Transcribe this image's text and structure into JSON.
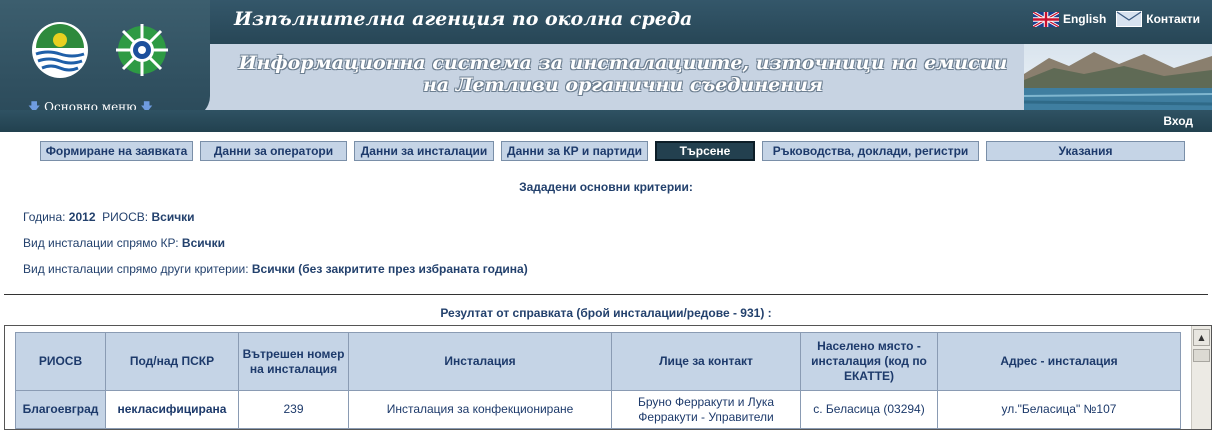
{
  "header": {
    "agency_title": "Изпълнителна агенция по околна среда",
    "system_title": "Информационна система за инсталациите, източници на емисии на Летливи органични съединения",
    "menu_label": "Основно меню",
    "english_label": "English",
    "contacts_label": "Контакти",
    "login_label": "Вход"
  },
  "nav": {
    "items": [
      "Формиране на заявката",
      "Данни за оператори",
      "Данни за инсталации",
      "Данни за КР и партиди",
      "Търсене",
      "Ръководства, доклади, регистри",
      "Указания"
    ],
    "active": "Търсене"
  },
  "criteria": {
    "heading": "Зададени основни критерии:",
    "year_label": "Година:",
    "year_value": "2012",
    "riosv_label": "РИОСВ:",
    "riosv_value": "Всички",
    "kr_label": "Вид инсталации спрямо КР:",
    "kr_value": "Всички",
    "other_label": "Вид инсталации спрямо други критерии:",
    "other_value": "Всички (без закритите през избраната година)"
  },
  "results": {
    "heading": "Резултат от справката (брой инсталации/редове - 931) :",
    "columns": [
      "РИОСВ",
      "Под/над ПСКР",
      "Вътрешен номер на инсталация",
      "Инсталация",
      "Лице за контакт",
      "Населено място - инсталация (код по ЕКАТТЕ)",
      "Адрес - инсталация"
    ],
    "rows": [
      {
        "riosv": "Благоевград",
        "pskr": "некласифицирана",
        "internal_no": "239",
        "installation": "Инсталация за конфекциониране",
        "contact": "Бруно Ферракути и Лука Ферракути - Управители",
        "settlement": "с. Беласица (03294)",
        "address": "ул.\"Беласица\" №107"
      }
    ]
  },
  "colors": {
    "header_dark": "#2b4a5a",
    "header_light": "#c7d3e2",
    "button_bg": "#c5d4e6",
    "button_active": "#23404f",
    "text_blue": "#1d3a6b"
  }
}
